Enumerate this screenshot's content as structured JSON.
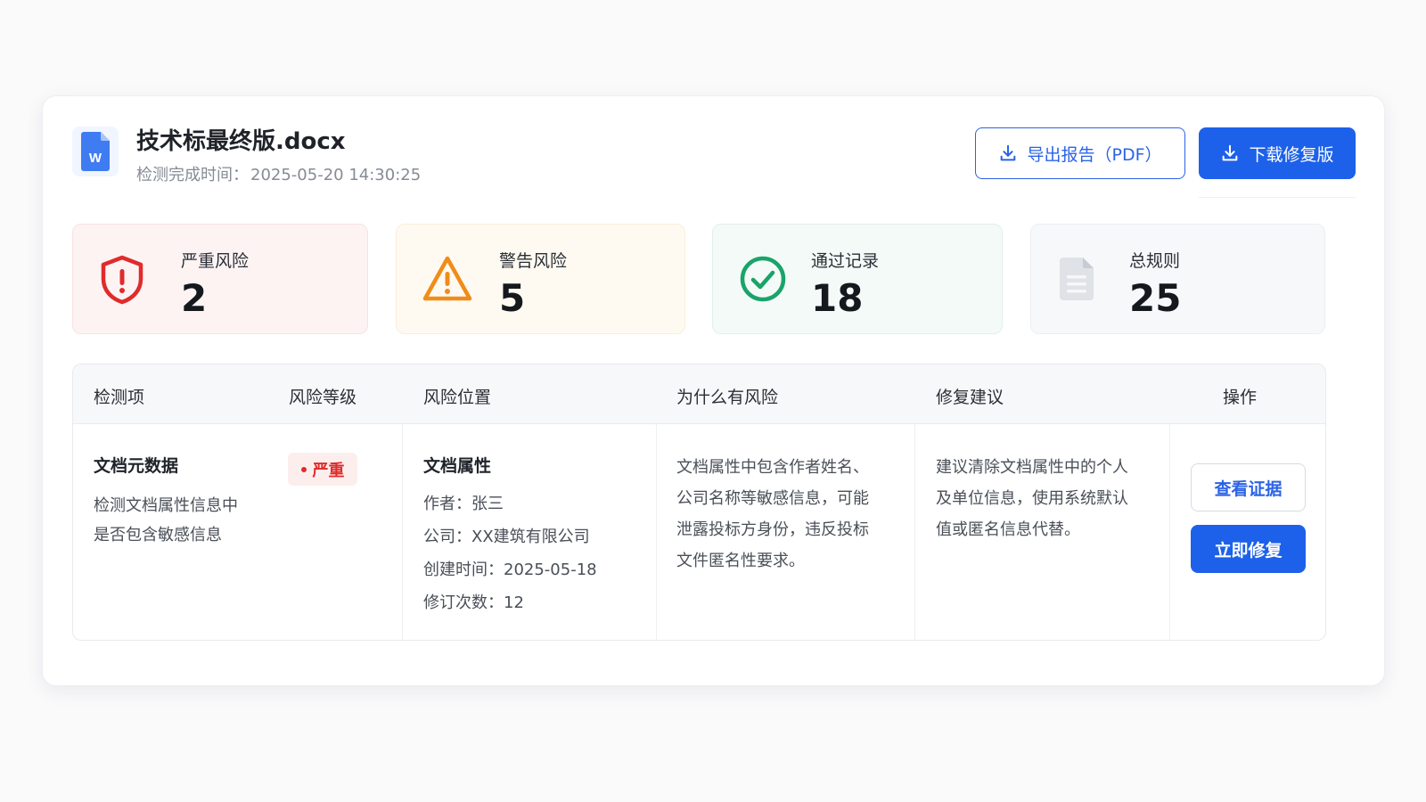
{
  "header": {
    "file_name": "技术标最终版.docx",
    "time_label": "检测完成时间：",
    "time_value": "2025-05-20 14:30:25",
    "file_icon": "word-document-icon",
    "export_label": "导出报告（PDF）",
    "download_label": "下载修复版"
  },
  "stats": {
    "critical": {
      "label": "严重风险",
      "value": "2",
      "icon": "shield-alert-icon",
      "color": "#e02b2b"
    },
    "warning": {
      "label": "警告风险",
      "value": "5",
      "icon": "warning-triangle-icon",
      "color": "#f08c1a"
    },
    "pass": {
      "label": "通过记录",
      "value": "18",
      "icon": "check-circle-icon",
      "color": "#1aa36a"
    },
    "total": {
      "label": "总规则",
      "value": "25",
      "icon": "document-icon",
      "color": "#c7cbd2"
    }
  },
  "table": {
    "headers": {
      "item": "检测项",
      "level": "风险等级",
      "location": "风险位置",
      "reason": "为什么有风险",
      "suggestion": "修复建议",
      "action": "操作"
    },
    "row": {
      "item_title": "文档元数据",
      "item_desc": [
        "检测文档属性信息中",
        "是否包含敏感信息"
      ],
      "level": "严重",
      "location_title": "文档属性",
      "location_lines": [
        "作者：张三",
        "公司：XX建筑有限公司",
        "创建时间：2025-05-18",
        "修订次数：12"
      ],
      "reason_lines": [
        "文档属性中包含作者姓名、",
        "公司名称等敏感信息，可能",
        "泄露投标方身份，违反投标",
        "文件匿名性要求。"
      ],
      "suggestion_lines": [
        "建议清除文档属性中的个人",
        "及单位信息，使用系统默认",
        "值或匿名信息代替。"
      ],
      "evidence_label": "查看证据",
      "fix_label": "立即修复"
    }
  }
}
